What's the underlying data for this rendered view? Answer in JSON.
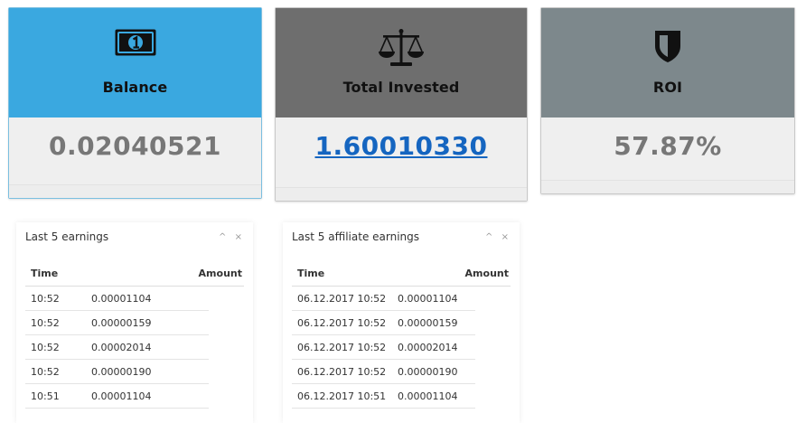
{
  "cards": {
    "balance": {
      "title": "Balance",
      "value": "0.02040521",
      "icon": "banknote-icon",
      "color": "#3aa8e0"
    },
    "invested": {
      "title": "Total Invested",
      "value": "1.60010330",
      "icon": "scales-icon",
      "color": "#6e6e6e"
    },
    "roi": {
      "title": "ROI",
      "value": "57.87%",
      "icon": "shield-icon",
      "color": "#7d888c"
    }
  },
  "earnings": {
    "title": "Last 5 earnings",
    "columns": {
      "time": "Time",
      "amount": "Amount"
    },
    "rows": [
      {
        "time": "10:52",
        "amount": "0.00001104"
      },
      {
        "time": "10:52",
        "amount": "0.00000159"
      },
      {
        "time": "10:52",
        "amount": "0.00002014"
      },
      {
        "time": "10:52",
        "amount": "0.00000190"
      },
      {
        "time": "10:51",
        "amount": "0.00001104"
      }
    ]
  },
  "affiliate": {
    "title": "Last 5 affiliate earnings",
    "columns": {
      "time": "Time",
      "amount": "Amount"
    },
    "rows": [
      {
        "time": "06.12.2017 10:52",
        "amount": "0.00001104"
      },
      {
        "time": "06.12.2017 10:52",
        "amount": "0.00000159"
      },
      {
        "time": "06.12.2017 10:52",
        "amount": "0.00002014"
      },
      {
        "time": "06.12.2017 10:52",
        "amount": "0.00000190"
      },
      {
        "time": "06.12.2017 10:51",
        "amount": "0.00001104"
      }
    ]
  },
  "controls": {
    "collapse": "^",
    "close": "×"
  }
}
